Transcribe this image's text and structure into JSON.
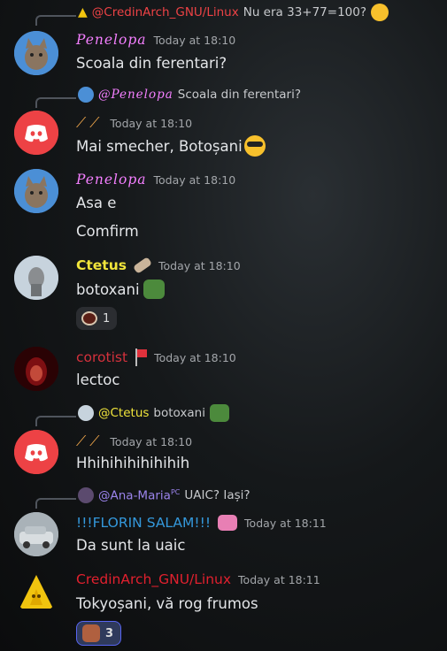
{
  "messages": [
    {
      "reply_user": "@CredinArch_GNU/Linux",
      "reply_text": "Nu era 33+77=100?"
    },
    {
      "user": "Penelopa",
      "time": "Today at 18:10",
      "text": "Scoala din ferentari?"
    },
    {
      "reply_user": "@Penelopa",
      "reply_text": "Scoala din ferentari?",
      "time": "Today at 18:10",
      "text": "Mai smecher, Botoșani"
    },
    {
      "user": "Penelopa",
      "time": "Today at 18:10",
      "lines": [
        "Asa e",
        "Comfirm"
      ]
    },
    {
      "user": "Ctetus",
      "time": "Today at 18:10",
      "text": "botoxani",
      "reaction_count": "1"
    },
    {
      "user": "corotist",
      "time": "Today at 18:10",
      "text": "lectoc"
    },
    {
      "reply_user": "@Ctetus",
      "reply_text": "botoxani",
      "time": "Today at 18:10",
      "text": "Hhihihihihihihih"
    },
    {
      "reply_user": "@Ana-Maria",
      "reply_tag": "PC",
      "reply_text": "UAIC? Iași?"
    },
    {
      "user": "!!!FLORIN SALAM!!!",
      "time": "Today at 18:11",
      "text": "Da sunt la uaic"
    },
    {
      "user": "CredinArch_GNU/Linux",
      "time": "Today at 18:11",
      "text": "Tokyoșani, vă rog frumos",
      "reaction_count": "3"
    }
  ],
  "colors": {
    "pink": "#f47fff",
    "red": "#ed4245",
    "yellow": "#f1c40f",
    "blue": "#3498db",
    "discord": "#ed4245"
  }
}
